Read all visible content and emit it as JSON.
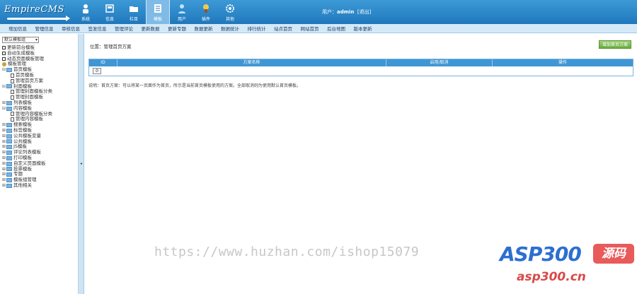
{
  "app": {
    "logo_text": "EmpireCMS"
  },
  "nav": [
    {
      "label": "系统",
      "icon": "person-icon"
    },
    {
      "label": "信息",
      "icon": "box-icon"
    },
    {
      "label": "栏目",
      "icon": "folder-icon"
    },
    {
      "label": "模板",
      "icon": "template-icon",
      "active": true
    },
    {
      "label": "用户",
      "icon": "user-icon"
    },
    {
      "label": "插件",
      "icon": "plugin-icon"
    },
    {
      "label": "其他",
      "icon": "gear-icon"
    }
  ],
  "user": {
    "prefix": "用户：",
    "name": "admin",
    "logout": "[退出]"
  },
  "subnav": [
    "增加信息",
    "管理信息",
    "审核信息",
    "签发信息",
    "管理评论",
    "更新数据",
    "更新专题",
    "数据更新",
    "数据统计",
    "排行统计",
    "站点首页",
    "网站首页",
    "后台地图",
    "版本更新"
  ],
  "sidebar": {
    "select_value": "默认模板组",
    "items": [
      {
        "type": "chk",
        "label": "更新前台模板",
        "level": 0
      },
      {
        "type": "chk",
        "label": "自动生成模板",
        "level": 0
      },
      {
        "type": "chk",
        "label": "动态页面模板管理",
        "level": 0
      },
      {
        "type": "gear",
        "label": "模板管理",
        "level": 0
      },
      {
        "type": "folder",
        "label": "首页模板",
        "level": 0,
        "ctl": "⊟"
      },
      {
        "type": "doc",
        "label": "首页模板",
        "level": 2
      },
      {
        "type": "doc",
        "label": "管理首页方案",
        "level": 2
      },
      {
        "type": "folder",
        "label": "封面模板",
        "level": 0,
        "ctl": "⊟"
      },
      {
        "type": "doc",
        "label": "管理封面模板分类",
        "level": 2
      },
      {
        "type": "doc",
        "label": "管理封面模板",
        "level": 2
      },
      {
        "type": "folder",
        "label": "列表模板",
        "level": 0,
        "ctl": "⊞"
      },
      {
        "type": "folder",
        "label": "内容模板",
        "level": 0,
        "ctl": "⊟"
      },
      {
        "type": "doc",
        "label": "管理内容模板分类",
        "level": 2
      },
      {
        "type": "doc",
        "label": "管理内容模板",
        "level": 2
      },
      {
        "type": "folder",
        "label": "搜索模板",
        "level": 0,
        "ctl": "⊞"
      },
      {
        "type": "folder",
        "label": "标签模板",
        "level": 0,
        "ctl": "⊞"
      },
      {
        "type": "folder",
        "label": "公共模板变量",
        "level": 0,
        "ctl": "⊞"
      },
      {
        "type": "folder",
        "label": "公共模板",
        "level": 0,
        "ctl": "⊞"
      },
      {
        "type": "folder",
        "label": "JS模板",
        "level": 0,
        "ctl": "⊞"
      },
      {
        "type": "folder",
        "label": "评论列表模板",
        "level": 0,
        "ctl": "⊞"
      },
      {
        "type": "folder",
        "label": "打印模板",
        "level": 0,
        "ctl": "⊞"
      },
      {
        "type": "folder",
        "label": "自定义页面模板",
        "level": 0,
        "ctl": "⊞"
      },
      {
        "type": "folder",
        "label": "投票模板",
        "level": 0,
        "ctl": "⊞"
      },
      {
        "type": "folder",
        "label": "专题",
        "level": 0,
        "ctl": "⊞"
      },
      {
        "type": "folder",
        "label": "模板组管理",
        "level": 0,
        "ctl": "⊞"
      },
      {
        "type": "folder",
        "label": "其他相关",
        "level": 0,
        "ctl": "⊞"
      }
    ]
  },
  "main": {
    "breadcrumb": "位置：管理首页方案",
    "add_button": "增加首页方案",
    "columns": [
      "ID",
      "方案名称",
      "启用/取消",
      "操作"
    ],
    "row_button": "0",
    "note": "说明：首页方案：可以将某一页面作为首页，所示是当前首页模板使用的方案。全部取消则为使用默认首页模板。"
  },
  "watermark": {
    "url_text": "https://www.huzhan.com/ishop15079",
    "brand": "ASP300",
    "badge": "源码",
    "site": "asp300.cn"
  }
}
